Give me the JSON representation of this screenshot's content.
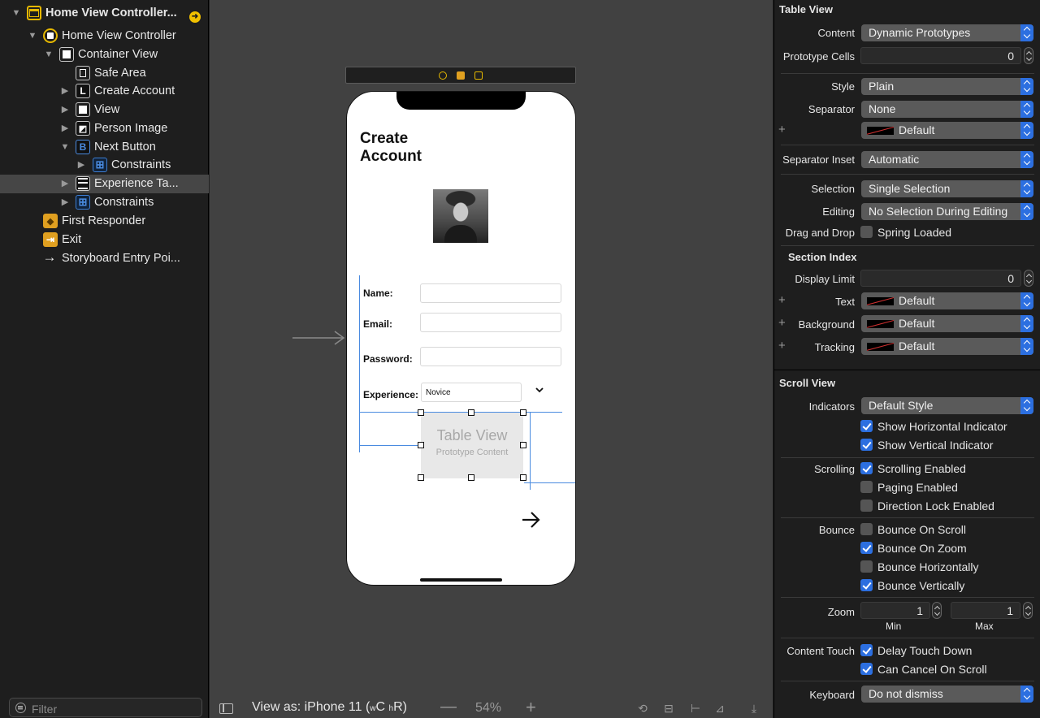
{
  "outline": {
    "items": [
      {
        "label": "Home View Controller...",
        "icon": "storyboard-scene-icon"
      },
      {
        "label": "Home View Controller",
        "icon": "view-controller-icon"
      },
      {
        "label": "Container View",
        "icon": "view-icon"
      },
      {
        "label": "Safe Area",
        "icon": "safe-area-icon"
      },
      {
        "label": "Create Account",
        "icon": "label-icon",
        "glyph": "L"
      },
      {
        "label": "View",
        "icon": "view-icon"
      },
      {
        "label": "Person Image",
        "icon": "image-icon"
      },
      {
        "label": "Next Button",
        "icon": "button-icon",
        "glyph": "B"
      },
      {
        "label": "Constraints",
        "icon": "constraints-icon"
      },
      {
        "label": "Experience Ta...",
        "icon": "table-view-icon"
      },
      {
        "label": "Constraints",
        "icon": "constraints-icon"
      },
      {
        "label": "First Responder",
        "icon": "first-responder-icon"
      },
      {
        "label": "Exit",
        "icon": "exit-icon"
      },
      {
        "label": "Storyboard Entry Poi...",
        "icon": "entry-arrow-icon",
        "glyph": "→"
      }
    ],
    "filter_placeholder": "Filter"
  },
  "canvas": {
    "screen_title": "Create Account",
    "fields": [
      {
        "label": "Name:",
        "value": ""
      },
      {
        "label": "Email:",
        "value": ""
      },
      {
        "label": "Password:",
        "value": ""
      }
    ],
    "experience_label": "Experience:",
    "experience_value": "Novice",
    "table_view_title": "Table View",
    "table_view_subtitle": "Prototype Content",
    "bottom": {
      "view_as_prefix": "View as: iPhone 11 (",
      "w_small": "w",
      "w_big": "C",
      "h_small": "h",
      "h_big": "R",
      "suffix": ")",
      "zoom_minus": "—",
      "zoom_level": "54%",
      "zoom_plus": "+"
    }
  },
  "inspector": {
    "table_view": {
      "section_title": "Table View",
      "content_label": "Content",
      "content_value": "Dynamic Prototypes",
      "prototype_cells_label": "Prototype Cells",
      "prototype_cells_value": "0",
      "style_label": "Style",
      "style_value": "Plain",
      "separator_label": "Separator",
      "separator_value": "None",
      "separator_color_value": "Default",
      "separator_inset_label": "Separator Inset",
      "separator_inset_value": "Automatic",
      "selection_label": "Selection",
      "selection_value": "Single Selection",
      "editing_label": "Editing",
      "editing_value": "No Selection During Editing",
      "drag_drop_label": "Drag and Drop",
      "spring_loaded_label": "Spring Loaded",
      "spring_loaded_checked": false
    },
    "section_index": {
      "section_title": "Section Index",
      "display_limit_label": "Display Limit",
      "display_limit_value": "0",
      "text_label": "Text",
      "text_value": "Default",
      "background_label": "Background",
      "background_value": "Default",
      "tracking_label": "Tracking",
      "tracking_value": "Default"
    },
    "scroll_view": {
      "section_title": "Scroll View",
      "indicators_label": "Indicators",
      "indicators_value": "Default Style",
      "show_horizontal": "Show Horizontal Indicator",
      "show_vertical": "Show Vertical Indicator",
      "scrolling_label": "Scrolling",
      "scrolling_enabled": "Scrolling Enabled",
      "paging_enabled": "Paging Enabled",
      "direction_lock": "Direction Lock Enabled",
      "bounce_label": "Bounce",
      "bounce_on_scroll": "Bounce On Scroll",
      "bounce_on_zoom": "Bounce On Zoom",
      "bounce_horizontally": "Bounce Horizontally",
      "bounce_vertically": "Bounce Vertically",
      "zoom_label": "Zoom",
      "zoom_min_value": "1",
      "zoom_max_value": "1",
      "zoom_min_label": "Min",
      "zoom_max_label": "Max",
      "content_touch_label": "Content Touch",
      "delay_touch_down": "Delay Touch Down",
      "can_cancel_on_scroll": "Can Cancel On Scroll",
      "keyboard_label": "Keyboard",
      "keyboard_value": "Do not dismiss",
      "checks": {
        "show_horizontal": true,
        "show_vertical": true,
        "scrolling_enabled": true,
        "paging_enabled": false,
        "direction_lock": false,
        "bounce_on_scroll": false,
        "bounce_on_zoom": true,
        "bounce_horizontally": false,
        "bounce_vertically": true,
        "delay_touch_down": true,
        "can_cancel_on_scroll": true
      }
    }
  },
  "colors": {
    "accent": "#2c6fe0",
    "constraint": "#4a8be0",
    "storyboard": "#e6b800"
  }
}
